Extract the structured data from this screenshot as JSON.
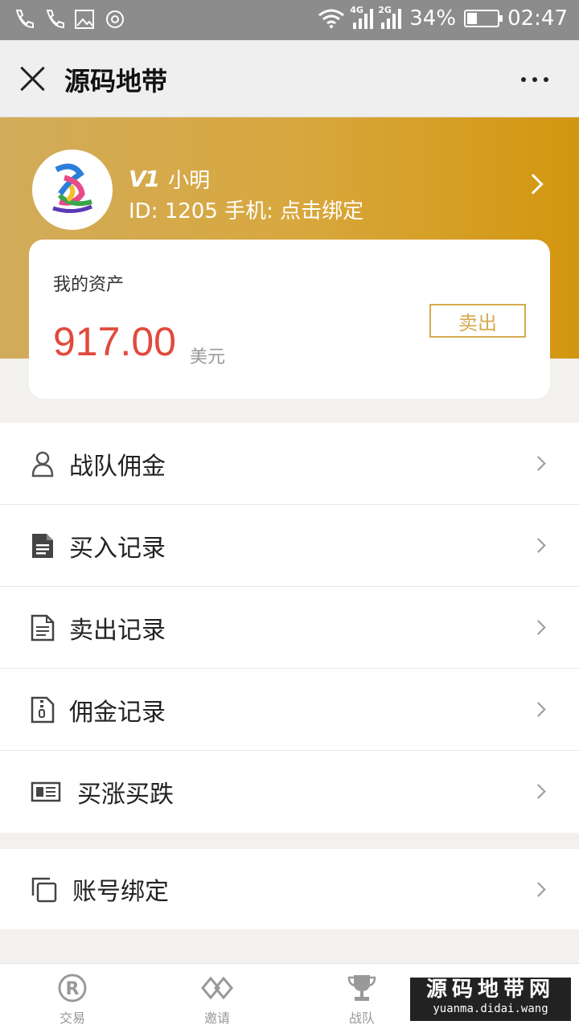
{
  "status_bar": {
    "network_4g": "4G",
    "network_2g": "2G",
    "battery": "34%",
    "battery_level": 0.34,
    "time": "02:47",
    "icons": [
      "phone-icon",
      "phone-icon",
      "image-icon",
      "settings-icon",
      "wifi-icon"
    ]
  },
  "titlebar": {
    "title": "源码地带",
    "close_icon": "close-icon",
    "more_icon": "more-icon"
  },
  "profile": {
    "name": "小明",
    "vip_badge": "V1",
    "id_line": "ID: 1205 手机: 点击绑定"
  },
  "assets": {
    "label": "我的资产",
    "value": "917.00",
    "unit": "美元",
    "sell_label": "卖出"
  },
  "menu_group_1": [
    {
      "label": "战队佣金",
      "icon": "user-icon"
    },
    {
      "label": "买入记录",
      "icon": "document-filled-icon"
    },
    {
      "label": "卖出记录",
      "icon": "document-icon"
    },
    {
      "label": "佣金记录",
      "icon": "zip-file-icon"
    },
    {
      "label": "买涨买跌",
      "icon": "newspaper-icon"
    }
  ],
  "menu_group_2": [
    {
      "label": "账号绑定",
      "icon": "copy-icon"
    }
  ],
  "bottom_nav": [
    {
      "label": "交易",
      "icon": "registered-icon"
    },
    {
      "label": "邀请",
      "icon": "diamond-link-icon"
    },
    {
      "label": "战队",
      "icon": "trophy-icon"
    }
  ],
  "watermark": {
    "cn": "源码地带网",
    "en": "yuanma.didai.wang"
  },
  "colors": {
    "accent_gold": "#d6ab4f",
    "value_red": "#e14a3c"
  }
}
